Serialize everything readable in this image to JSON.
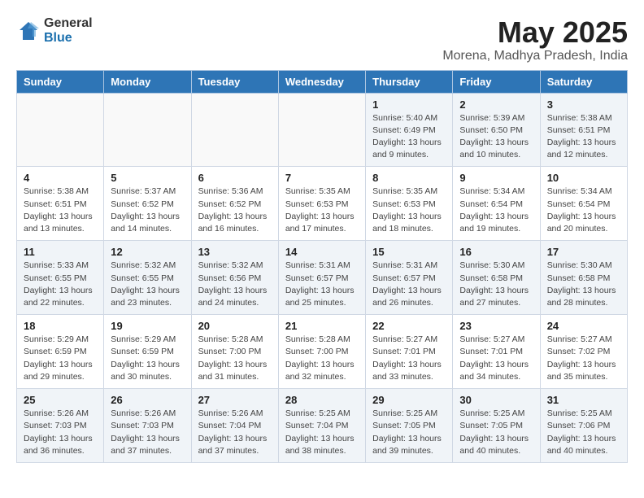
{
  "logo": {
    "general": "General",
    "blue": "Blue"
  },
  "title": "May 2025",
  "location": "Morena, Madhya Pradesh, India",
  "weekdays": [
    "Sunday",
    "Monday",
    "Tuesday",
    "Wednesday",
    "Thursday",
    "Friday",
    "Saturday"
  ],
  "weeks": [
    [
      {
        "day": "",
        "info": ""
      },
      {
        "day": "",
        "info": ""
      },
      {
        "day": "",
        "info": ""
      },
      {
        "day": "",
        "info": ""
      },
      {
        "day": "1",
        "info": "Sunrise: 5:40 AM\nSunset: 6:49 PM\nDaylight: 13 hours\nand 9 minutes."
      },
      {
        "day": "2",
        "info": "Sunrise: 5:39 AM\nSunset: 6:50 PM\nDaylight: 13 hours\nand 10 minutes."
      },
      {
        "day": "3",
        "info": "Sunrise: 5:38 AM\nSunset: 6:51 PM\nDaylight: 13 hours\nand 12 minutes."
      }
    ],
    [
      {
        "day": "4",
        "info": "Sunrise: 5:38 AM\nSunset: 6:51 PM\nDaylight: 13 hours\nand 13 minutes."
      },
      {
        "day": "5",
        "info": "Sunrise: 5:37 AM\nSunset: 6:52 PM\nDaylight: 13 hours\nand 14 minutes."
      },
      {
        "day": "6",
        "info": "Sunrise: 5:36 AM\nSunset: 6:52 PM\nDaylight: 13 hours\nand 16 minutes."
      },
      {
        "day": "7",
        "info": "Sunrise: 5:35 AM\nSunset: 6:53 PM\nDaylight: 13 hours\nand 17 minutes."
      },
      {
        "day": "8",
        "info": "Sunrise: 5:35 AM\nSunset: 6:53 PM\nDaylight: 13 hours\nand 18 minutes."
      },
      {
        "day": "9",
        "info": "Sunrise: 5:34 AM\nSunset: 6:54 PM\nDaylight: 13 hours\nand 19 minutes."
      },
      {
        "day": "10",
        "info": "Sunrise: 5:34 AM\nSunset: 6:54 PM\nDaylight: 13 hours\nand 20 minutes."
      }
    ],
    [
      {
        "day": "11",
        "info": "Sunrise: 5:33 AM\nSunset: 6:55 PM\nDaylight: 13 hours\nand 22 minutes."
      },
      {
        "day": "12",
        "info": "Sunrise: 5:32 AM\nSunset: 6:55 PM\nDaylight: 13 hours\nand 23 minutes."
      },
      {
        "day": "13",
        "info": "Sunrise: 5:32 AM\nSunset: 6:56 PM\nDaylight: 13 hours\nand 24 minutes."
      },
      {
        "day": "14",
        "info": "Sunrise: 5:31 AM\nSunset: 6:57 PM\nDaylight: 13 hours\nand 25 minutes."
      },
      {
        "day": "15",
        "info": "Sunrise: 5:31 AM\nSunset: 6:57 PM\nDaylight: 13 hours\nand 26 minutes."
      },
      {
        "day": "16",
        "info": "Sunrise: 5:30 AM\nSunset: 6:58 PM\nDaylight: 13 hours\nand 27 minutes."
      },
      {
        "day": "17",
        "info": "Sunrise: 5:30 AM\nSunset: 6:58 PM\nDaylight: 13 hours\nand 28 minutes."
      }
    ],
    [
      {
        "day": "18",
        "info": "Sunrise: 5:29 AM\nSunset: 6:59 PM\nDaylight: 13 hours\nand 29 minutes."
      },
      {
        "day": "19",
        "info": "Sunrise: 5:29 AM\nSunset: 6:59 PM\nDaylight: 13 hours\nand 30 minutes."
      },
      {
        "day": "20",
        "info": "Sunrise: 5:28 AM\nSunset: 7:00 PM\nDaylight: 13 hours\nand 31 minutes."
      },
      {
        "day": "21",
        "info": "Sunrise: 5:28 AM\nSunset: 7:00 PM\nDaylight: 13 hours\nand 32 minutes."
      },
      {
        "day": "22",
        "info": "Sunrise: 5:27 AM\nSunset: 7:01 PM\nDaylight: 13 hours\nand 33 minutes."
      },
      {
        "day": "23",
        "info": "Sunrise: 5:27 AM\nSunset: 7:01 PM\nDaylight: 13 hours\nand 34 minutes."
      },
      {
        "day": "24",
        "info": "Sunrise: 5:27 AM\nSunset: 7:02 PM\nDaylight: 13 hours\nand 35 minutes."
      }
    ],
    [
      {
        "day": "25",
        "info": "Sunrise: 5:26 AM\nSunset: 7:03 PM\nDaylight: 13 hours\nand 36 minutes."
      },
      {
        "day": "26",
        "info": "Sunrise: 5:26 AM\nSunset: 7:03 PM\nDaylight: 13 hours\nand 37 minutes."
      },
      {
        "day": "27",
        "info": "Sunrise: 5:26 AM\nSunset: 7:04 PM\nDaylight: 13 hours\nand 37 minutes."
      },
      {
        "day": "28",
        "info": "Sunrise: 5:25 AM\nSunset: 7:04 PM\nDaylight: 13 hours\nand 38 minutes."
      },
      {
        "day": "29",
        "info": "Sunrise: 5:25 AM\nSunset: 7:05 PM\nDaylight: 13 hours\nand 39 minutes."
      },
      {
        "day": "30",
        "info": "Sunrise: 5:25 AM\nSunset: 7:05 PM\nDaylight: 13 hours\nand 40 minutes."
      },
      {
        "day": "31",
        "info": "Sunrise: 5:25 AM\nSunset: 7:06 PM\nDaylight: 13 hours\nand 40 minutes."
      }
    ]
  ]
}
